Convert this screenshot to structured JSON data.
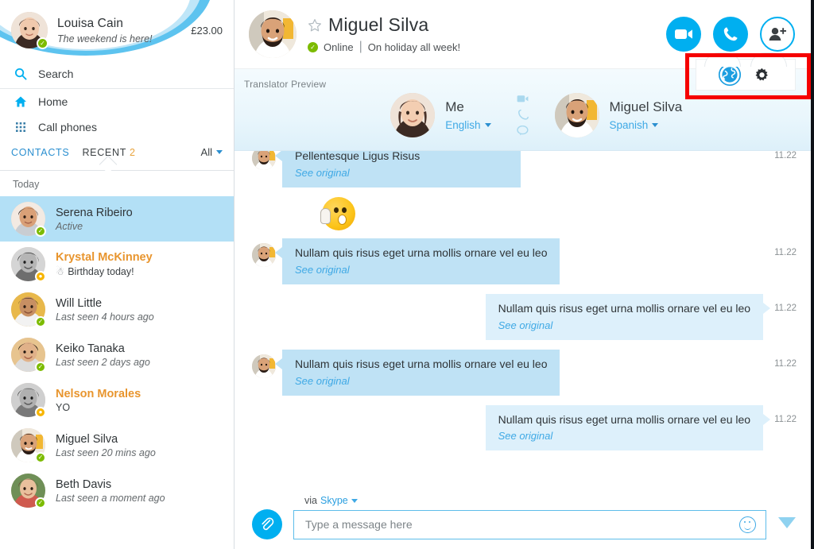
{
  "app": {
    "name": "Skype"
  },
  "sidebar": {
    "me": {
      "name": "Louisa Cain",
      "mood": "The weekend is here!",
      "credit": "£23.00",
      "presence": "online"
    },
    "search": {
      "label": "Search",
      "placeholder": "Search"
    },
    "nav": [
      {
        "label": "Home",
        "icon": "home-icon"
      },
      {
        "label": "Call phones",
        "icon": "dialpad-icon"
      }
    ],
    "tabs": {
      "contacts_label": "CONTACTS",
      "recent_label": "RECENT",
      "recent_count": "2",
      "filter_label": "All"
    },
    "day_label": "Today",
    "contacts": [
      {
        "name": "Serena Ribeiro",
        "status": "Active",
        "presence": "online",
        "selected": true,
        "unread": false,
        "birthday": false
      },
      {
        "name": "Krystal McKinney",
        "status": "Birthday today!",
        "presence": "away",
        "selected": false,
        "unread": true,
        "birthday": true
      },
      {
        "name": "Will Little",
        "status": "Last seen 4 hours ago",
        "presence": "online",
        "selected": false,
        "unread": false,
        "birthday": false
      },
      {
        "name": "Keiko Tanaka",
        "status": "Last seen 2 days ago",
        "presence": "online",
        "selected": false,
        "unread": false,
        "birthday": false
      },
      {
        "name": "Nelson Morales",
        "status": "YO",
        "presence": "away",
        "selected": false,
        "unread": true,
        "birthday": false
      },
      {
        "name": "Miguel Silva",
        "status": "Last seen 20 mins ago",
        "presence": "online",
        "selected": false,
        "unread": false,
        "birthday": false
      },
      {
        "name": "Beth Davis",
        "status": "Last seen a moment ago",
        "presence": "online",
        "selected": false,
        "unread": false,
        "birthday": false
      }
    ]
  },
  "header": {
    "peer_name": "Miguel Silva",
    "presence_label": "Online",
    "separator": "|",
    "mood": "On holiday all week!",
    "favorite_icon": "star-outline-icon",
    "actions": [
      {
        "name": "video-call-button",
        "icon": "video-camera-icon"
      },
      {
        "name": "audio-call-button",
        "icon": "phone-icon"
      },
      {
        "name": "add-people-button",
        "icon": "add-person-icon"
      }
    ]
  },
  "settings_pill": {
    "translator_icon": "globe-translator-icon",
    "settings_icon": "gear-icon",
    "highlighted": true
  },
  "translator": {
    "label": "Translator Preview",
    "left": {
      "name": "Me",
      "language": "English"
    },
    "right": {
      "name": "Miguel Silva",
      "language": "Spanish"
    },
    "mode_icons": [
      "video-camera-icon",
      "phone-icon",
      "chat-bubble-icon"
    ]
  },
  "transcript": {
    "see_original_label": "See original",
    "messages": [
      {
        "type": "text",
        "dir": "in",
        "text": "Pellentesque Ligus Risus",
        "translated": true,
        "time": "11.22",
        "clipped": true
      },
      {
        "type": "emoji",
        "dir": "in",
        "emoji": "shush-surprised-emoji",
        "time": ""
      },
      {
        "type": "text",
        "dir": "in",
        "text": "Nullam quis risus eget urna mollis ornare vel eu leo",
        "translated": true,
        "time": "11.22"
      },
      {
        "type": "text",
        "dir": "out",
        "text": "Nullam quis risus eget urna mollis ornare vel eu leo",
        "translated": true,
        "time": "11.22"
      },
      {
        "type": "text",
        "dir": "in",
        "text": "Nullam quis risus eget urna mollis ornare vel eu leo",
        "translated": true,
        "time": "11.22"
      },
      {
        "type": "text",
        "dir": "out",
        "text": "Nullam quis risus eget urna mollis ornare vel eu leo",
        "translated": true,
        "time": "11.22"
      }
    ]
  },
  "compose": {
    "via_prefix": "via",
    "via_channel": "Skype",
    "placeholder": "Type a message here",
    "value": "",
    "attach_icon": "paperclip-icon",
    "emoji_icon": "smiley-icon",
    "send_icon": "send-arrow-icon"
  },
  "colors": {
    "accent": "#00aff0",
    "link": "#3fa9e5",
    "unread": "#e8952e",
    "online": "#7cbb00",
    "away": "#f7b500",
    "bubble_in": "#bfe2f5",
    "bubble_out": "#ddf0fb",
    "selected_row": "#b3e0f6",
    "callout": "#f50000"
  }
}
